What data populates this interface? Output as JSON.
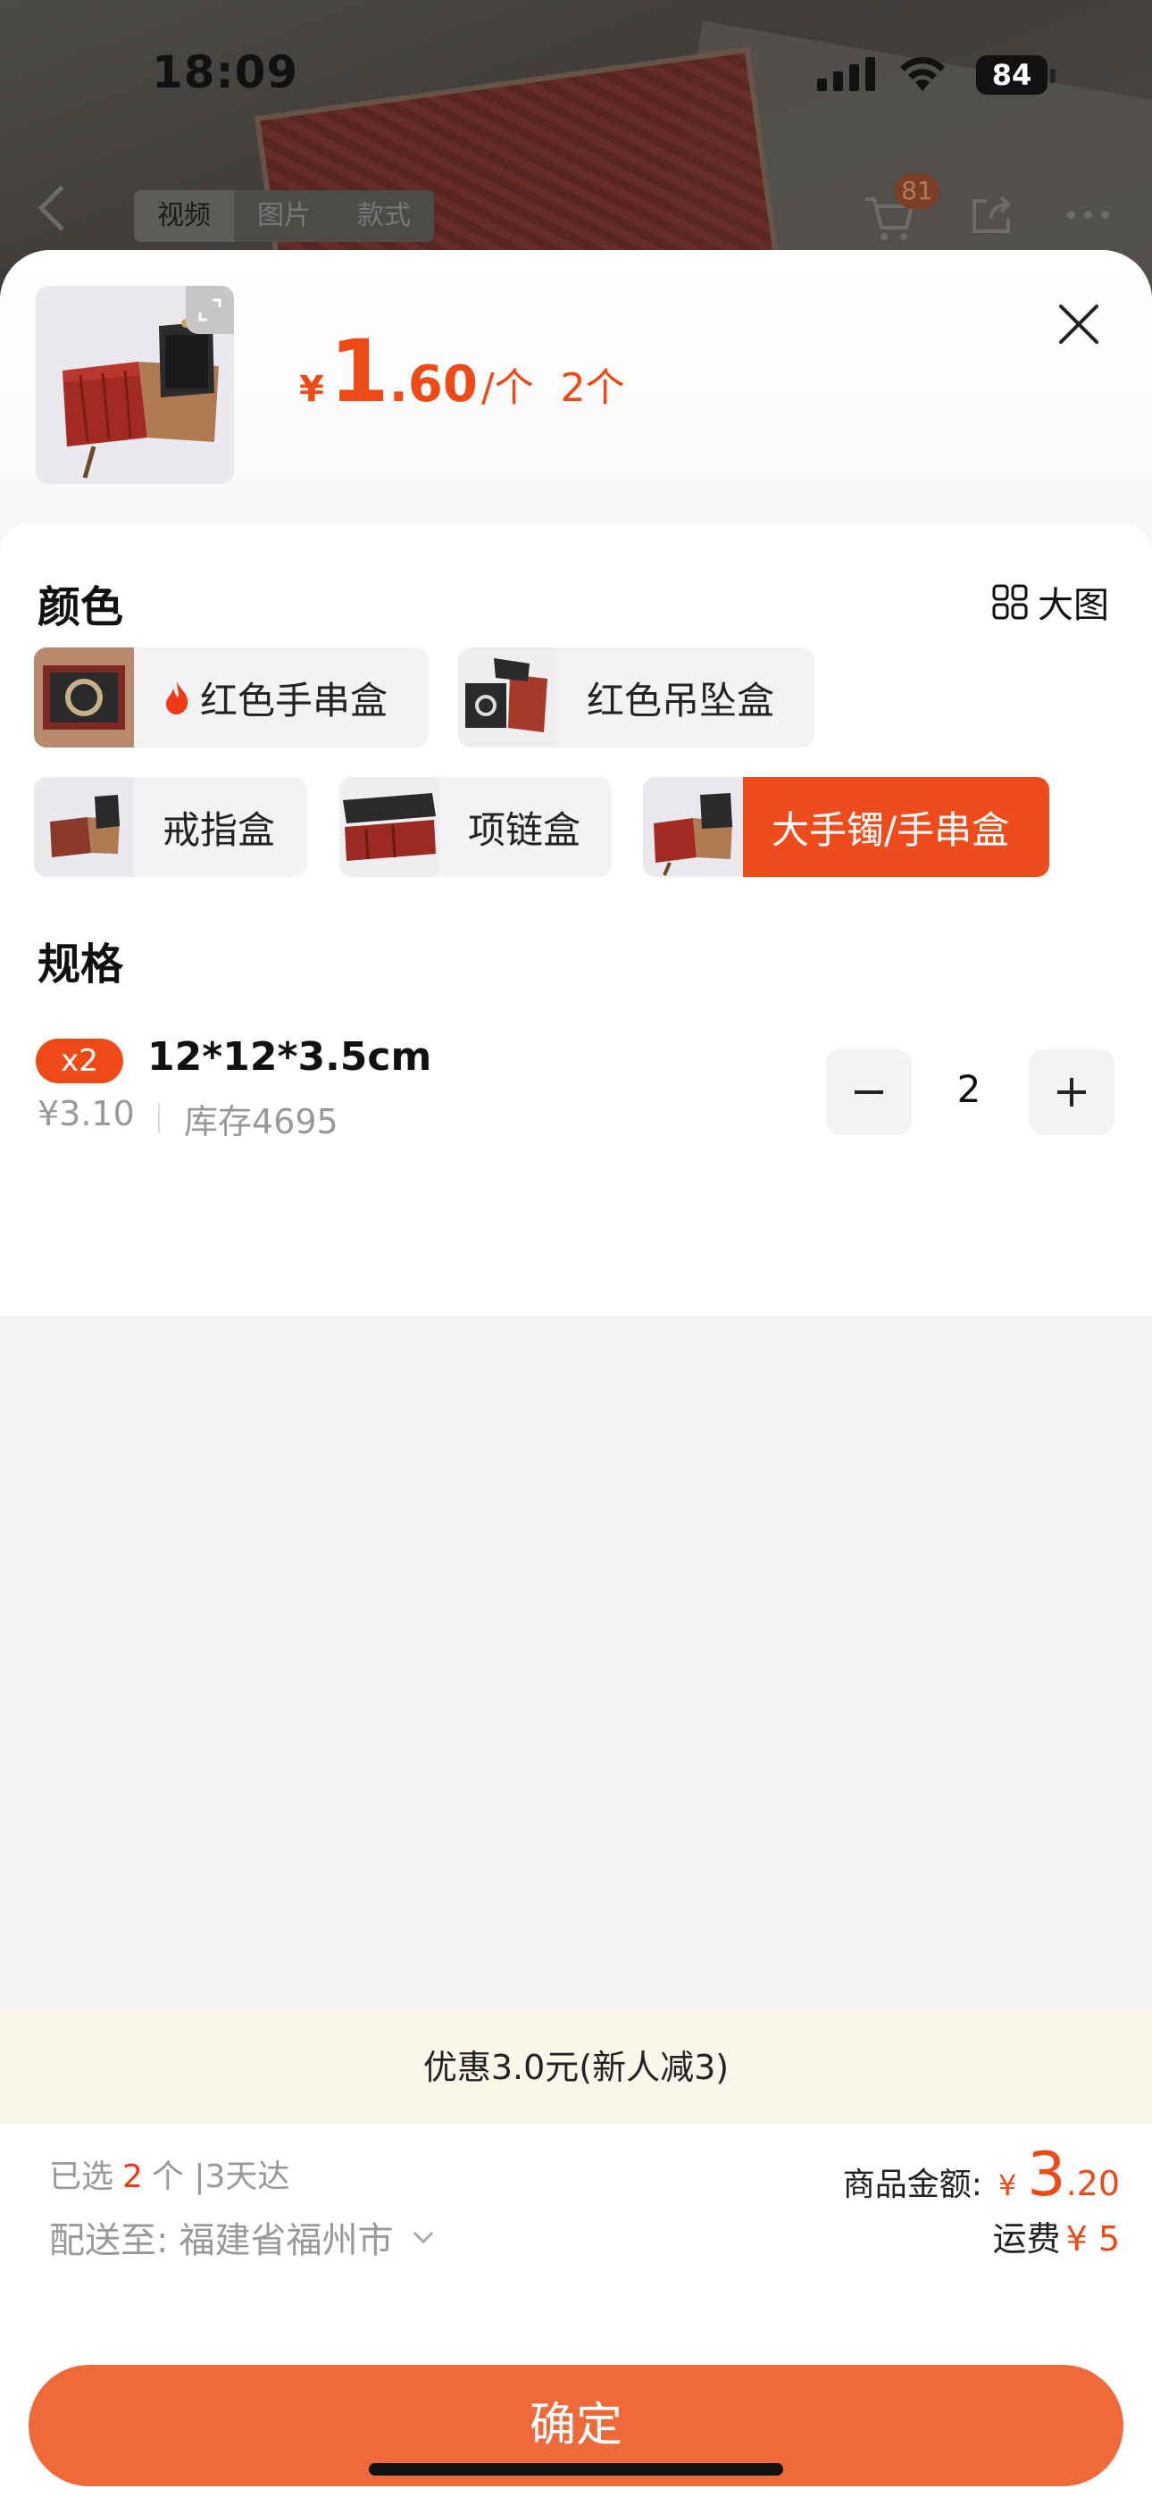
{
  "status_bar": {
    "time": "18:09",
    "battery": "84"
  },
  "nav": {
    "tabs": [
      "视频",
      "图片",
      "款式"
    ],
    "cart_count": "81"
  },
  "header": {
    "currency": "¥",
    "price_int": "1",
    "price_dec": ".60",
    "price_unit": "/个",
    "quantity": "2个"
  },
  "color_section": {
    "title": "颜色",
    "big_image_label": "大图",
    "options": [
      {
        "label": "红色手串盒",
        "hot": true,
        "selected": false
      },
      {
        "label": "红色吊坠盒",
        "hot": false,
        "selected": false
      },
      {
        "label": "戒指盒",
        "hot": false,
        "selected": false
      },
      {
        "label": "项链盒",
        "hot": false,
        "selected": false
      },
      {
        "label": "大手镯/手串盒",
        "hot": false,
        "selected": true
      }
    ]
  },
  "spec_section": {
    "title": "规格",
    "badge": "x2",
    "name": "12*12*3.5cm",
    "price": "¥3.10",
    "stock": "库存4695",
    "quantity": "2"
  },
  "promo": {
    "text": "优惠3.0元(新人减3)"
  },
  "footer": {
    "selected_prefix": "已选",
    "selected_count": "2",
    "selected_suffix": "个 |3天达",
    "ship_label": "配送至:",
    "ship_location": "福建省福州市",
    "total_label": "商品金额:",
    "total_currency": "¥",
    "total_int": "3",
    "total_dec": ".20",
    "fee_label": "运费",
    "fee_value": "¥ 5",
    "confirm_label": "确定"
  },
  "colors": {
    "accent": "#ee4a18",
    "button": "#ef6a3b",
    "promo_bg": "#fbf6ea"
  }
}
